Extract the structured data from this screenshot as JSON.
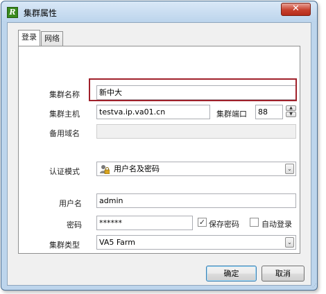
{
  "window": {
    "title": "集群属性",
    "app_icon_glyph": "R",
    "close_glyph": "✕"
  },
  "tabs": [
    {
      "label": "登录",
      "selected": true
    },
    {
      "label": "网络",
      "selected": false
    }
  ],
  "form": {
    "cluster_name": {
      "label": "集群名称",
      "value": "新中大"
    },
    "cluster_host": {
      "label": "集群主机",
      "value": "testva.ip.va01.cn"
    },
    "cluster_port": {
      "label": "集群端口",
      "value": "88"
    },
    "backup_domain": {
      "label": "备用域名",
      "value": ""
    },
    "auth_mode": {
      "label": "认证模式",
      "value": "用户名及密码",
      "icon": "user-lock-icon"
    },
    "username": {
      "label": "用户名",
      "value": "admin"
    },
    "password": {
      "label": "密码",
      "value": "******"
    },
    "save_password": {
      "label": "保存密码",
      "checked": true
    },
    "auto_login": {
      "label": "自动登录",
      "checked": false
    },
    "cluster_type": {
      "label": "集群类型",
      "value": "VA5 Farm"
    }
  },
  "buttons": {
    "ok": "确定",
    "cancel": "取消"
  },
  "glyphs": {
    "combo_arrow": "⌄",
    "spin_up": "▲",
    "spin_down": "▼",
    "check": "✓",
    "grip": "⋰"
  },
  "colors": {
    "title_bar": "#bcd4ec",
    "close_button": "#c7402d",
    "highlight_box": "#a0202a",
    "default_button_border": "#3c7fb1"
  }
}
